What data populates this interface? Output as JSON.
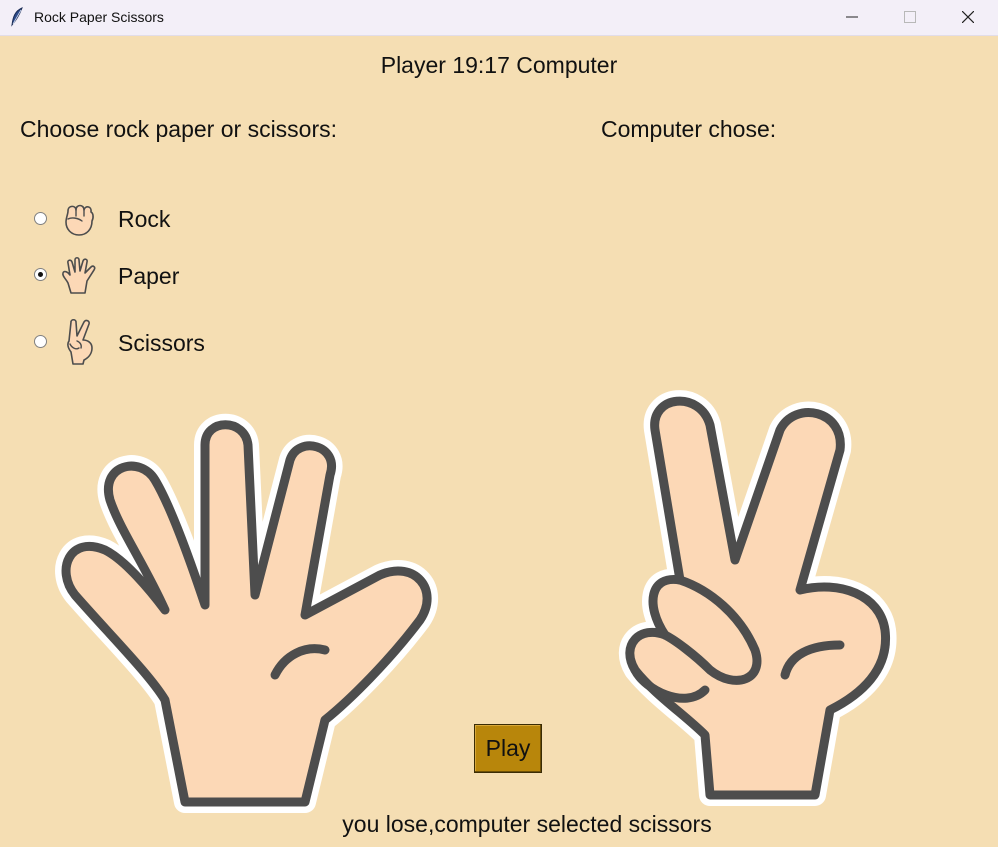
{
  "window": {
    "title": "Rock Paper Scissors"
  },
  "score": {
    "text": "Player 19:17 Computer"
  },
  "prompt": "Choose rock paper or scissors:",
  "computer_label": "Computer chose:",
  "options": [
    {
      "label": "Rock",
      "icon": "rock-hand-icon",
      "selected": false
    },
    {
      "label": "Paper",
      "icon": "paper-hand-icon",
      "selected": true
    },
    {
      "label": "Scissors",
      "icon": "scissors-hand-icon",
      "selected": false
    }
  ],
  "player_choice_image": "paper-hand-icon",
  "computer_choice_image": "scissors-hand-icon",
  "play_button": "Play",
  "result": "you lose,computer selected scissors",
  "colors": {
    "background": "#f5deb3",
    "skin": "#fcd8b6",
    "outline": "#4d4d4d",
    "play_button": "#b8860b"
  }
}
